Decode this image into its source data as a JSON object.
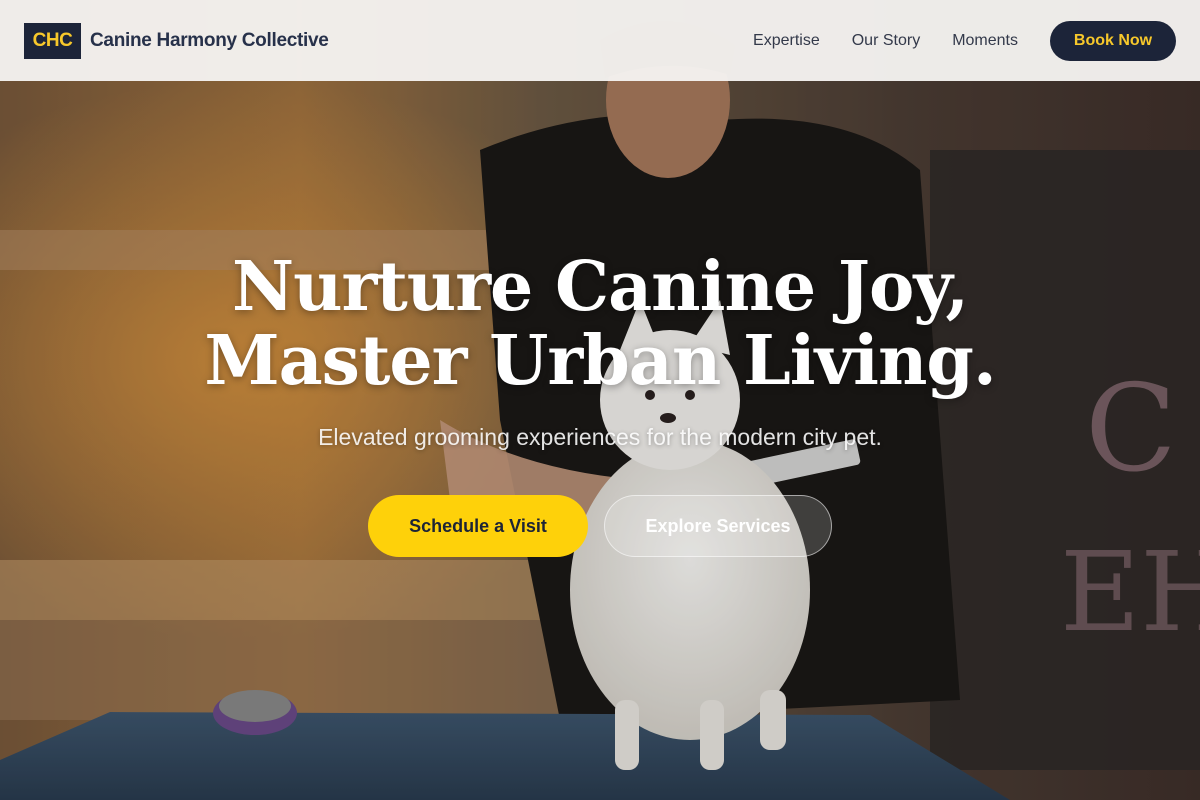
{
  "brand": {
    "badge": "CHC",
    "name": "Canine Harmony Collective"
  },
  "nav": {
    "items": [
      {
        "label": "Expertise"
      },
      {
        "label": "Our Story"
      },
      {
        "label": "Moments"
      }
    ],
    "cta_label": "Book Now"
  },
  "hero": {
    "title_line1": "Nurture Canine Joy,",
    "title_line2": "Master Urban Living.",
    "subtitle": "Elevated grooming experiences for the modern city pet.",
    "primary_cta": "Schedule a Visit",
    "secondary_cta": "Explore Services",
    "image_subject": "groomer-with-white-pomeranian-photo"
  },
  "colors": {
    "navy": "#1c2439",
    "accent_yellow": "#fed10a",
    "header_bg": "#f5f3f0"
  }
}
